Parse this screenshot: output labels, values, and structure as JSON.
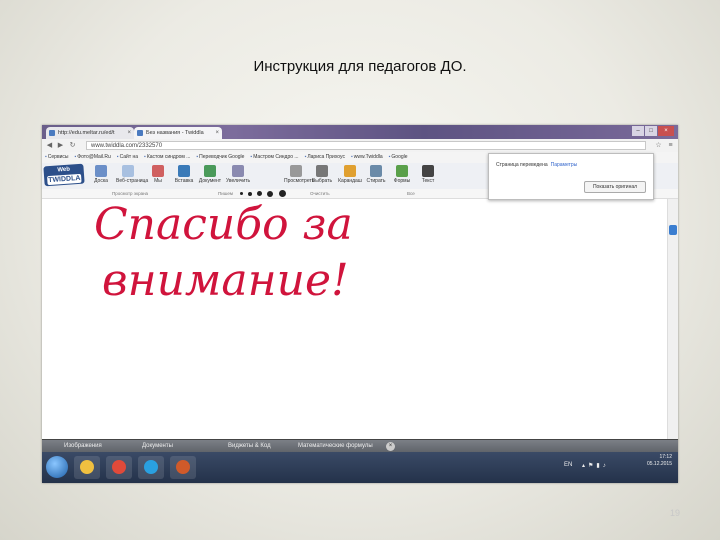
{
  "slide": {
    "title": "Инструкция для педагогов ДО.",
    "page_number": "19"
  },
  "browser": {
    "tabs": [
      {
        "label": "http://edu.meltar.ru/ed/t"
      },
      {
        "label": "Без названия - Twiddla"
      }
    ],
    "window_buttons": [
      "–",
      "□",
      "×"
    ],
    "url": "www.twiddla.com/2332570",
    "bookmarks": [
      "Сервисы",
      "Фото@Mail.Ru",
      "Сайт на",
      "Кастом синдром ...",
      "Переводчик Google",
      "Мастром Синдро ...",
      "Лариса Прихоус",
      "www.Twiddla",
      "Google"
    ]
  },
  "app": {
    "logo_top": "Web",
    "logo_bottom": "TWIDDLA",
    "tools": [
      {
        "label": "Доска",
        "color": "#6b8fc8"
      },
      {
        "label": "Веб-страница",
        "color": "#a8c0e0"
      },
      {
        "label": "Мы",
        "color": "#d06060"
      },
      {
        "label": "Вставка",
        "color": "#3a7ab8"
      },
      {
        "label": "Документ",
        "color": "#4a9a5a"
      },
      {
        "label": "Увеличить",
        "color": "#8a8ab0"
      },
      {
        "label": "Просмотреть",
        "color": "#999999"
      },
      {
        "label": "Выбрать",
        "color": "#777777"
      },
      {
        "label": "Карандаш",
        "color": "#e0a030"
      },
      {
        "label": "Стирать",
        "color": "#6a8aa8"
      },
      {
        "label": "Формы",
        "color": "#5aa04a"
      },
      {
        "label": "Текст",
        "color": "#444444"
      }
    ],
    "subtoolbar": {
      "left_label": "Просмотр экрана",
      "pen_label": "Пишем",
      "clear_label": "Очистить",
      "all_label": "Все"
    },
    "popup": {
      "text": "Страница переведена",
      "link": "Параметры",
      "button": "Показать оригинал"
    },
    "handwriting_line1": "Спасибо за",
    "handwriting_line2": "внимание!",
    "ink_color": "#d0143c",
    "bottom_panel": [
      "Изображения",
      "Документы",
      "Виджеты & Код",
      "Математические формулы"
    ],
    "bottom_close": "×"
  },
  "taskbar": {
    "lang": "EN",
    "time": "17:12",
    "date": "05.12.2015",
    "apps": [
      {
        "name": "explorer",
        "color": "#f0c040"
      },
      {
        "name": "chrome",
        "color": "#e04a3a"
      },
      {
        "name": "skype",
        "color": "#2aa0e0"
      },
      {
        "name": "powerpoint",
        "color": "#d05a2a"
      }
    ]
  }
}
